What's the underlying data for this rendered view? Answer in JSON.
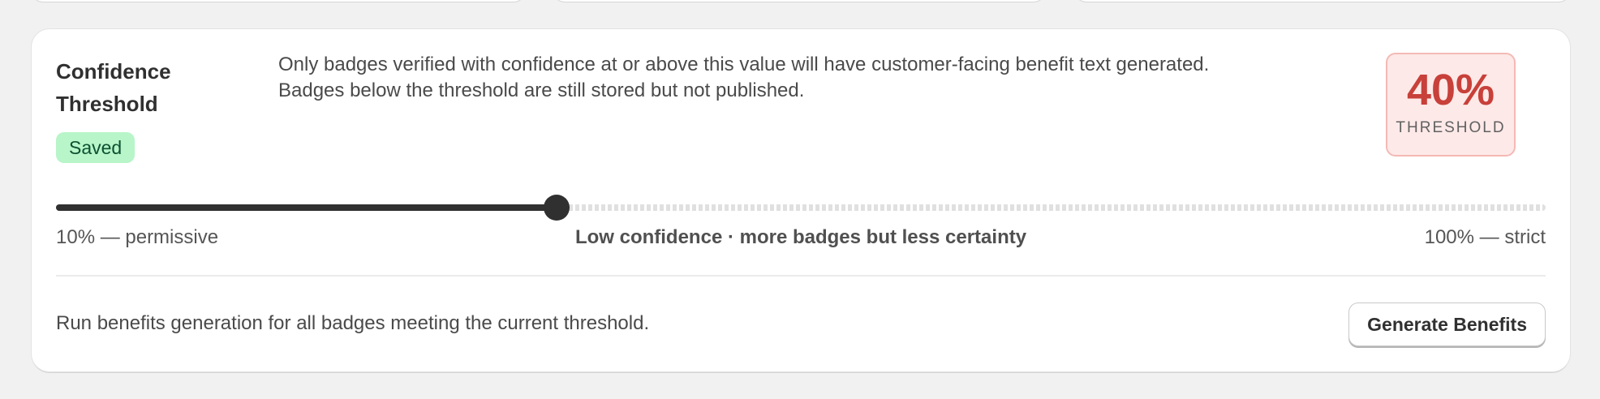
{
  "card": {
    "title": "Confidence Threshold",
    "status_badge": "Saved",
    "description": [
      "Only badges verified with confidence at or above this value will have customer-facing benefit text generated.",
      "Badges below the threshold are still stored but not published."
    ]
  },
  "threshold": {
    "value_text": "40%",
    "label": "THRESHOLD",
    "accent_color": "#c8403a"
  },
  "slider": {
    "min": 10,
    "max": 100,
    "value": 40,
    "min_label": "10% — permissive",
    "max_label": "100% — strict",
    "hint": "Low confidence · more badges but less certainty"
  },
  "footer": {
    "run_text": "Run benefits generation for all badges meeting the current threshold.",
    "generate_button": "Generate Benefits"
  },
  "colors": {
    "saved_badge_bg": "#b8f5c8",
    "saved_badge_text": "#0c5132",
    "threshold_bg": "#fde9e8",
    "slider_fill": "#303030"
  }
}
